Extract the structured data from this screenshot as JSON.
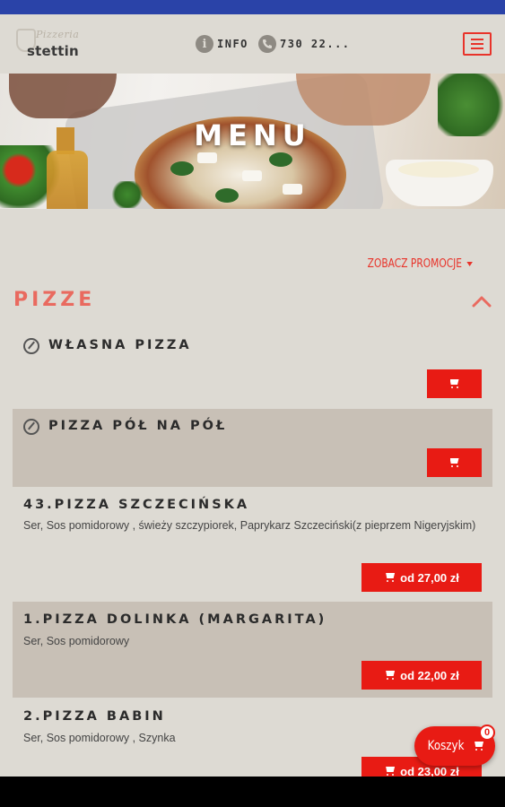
{
  "colors": {
    "accent": "#e81b14",
    "section_title": "#e96a5f",
    "status_bar": "#2a43a8",
    "background": "#dddad3",
    "shaded_row": "#c8c0b6"
  },
  "header": {
    "logo_top": "Pizzeria",
    "logo_main": "stettin",
    "info_icon": "info-icon",
    "info_label": "INFO",
    "phone_icon": "phone-icon",
    "phone_label": "730 22...",
    "menu_icon": "hamburger-menu-icon"
  },
  "hero": {
    "title": "MENU"
  },
  "promo": {
    "label": "ZOBACZ PROMOCJE"
  },
  "section": {
    "title": "PIZZE",
    "toggle_icon": "chevron-up-icon"
  },
  "items": [
    {
      "title": "WŁASNA PIZZA",
      "icon": "edit-icon",
      "description": "",
      "price_label": "",
      "cart_icon": "cart-icon"
    },
    {
      "title": "PIZZA PÓŁ NA PÓŁ",
      "icon": "edit-icon",
      "description": "",
      "price_label": "",
      "cart_icon": "cart-icon"
    },
    {
      "title": "43.PIZZA SZCZECIŃSKA",
      "description": "Ser, Sos pomidorowy , świeży szczypiorek, Paprykarz Szczeciński(z pieprzem Nigeryjskim)",
      "price_label": "od 27,00 zł",
      "cart_icon": "cart-icon"
    },
    {
      "title": "1.PIZZA DOLINKA (MARGARITA)",
      "description": "Ser, Sos pomidorowy",
      "price_label": "od 22,00 zł",
      "cart_icon": "cart-icon"
    },
    {
      "title": "2.PIZZA BABIN",
      "description": "Ser, Sos pomidorowy , Szynka",
      "price_label": "od 23,00 zł",
      "cart_icon": "cart-icon"
    }
  ],
  "basket": {
    "label": "Koszyk",
    "count": "0",
    "icon": "cart-icon"
  }
}
